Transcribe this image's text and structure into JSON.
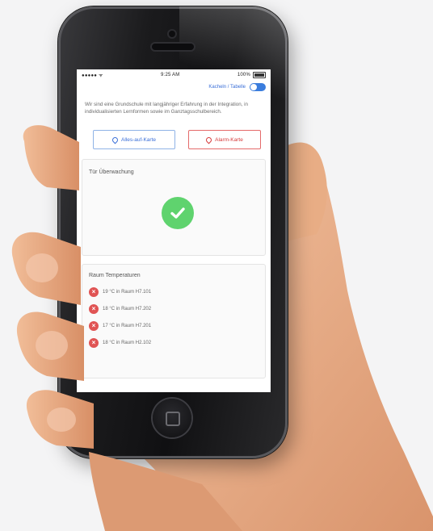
{
  "status_bar": {
    "carrier": "●●●●● ᯤ",
    "time": "9:25 AM",
    "battery": "100%"
  },
  "topbar": {
    "toggle_label": "Kacheln / Tabelle"
  },
  "intro_text": "Wir sind eine Grundschule mit langjähriger Erfahrung in der Integration, in individualisierten Lernformen sowie im Ganztagsschulbereich.",
  "buttons": {
    "all_map": "Alles-auf-Karte",
    "alarm_map": "Alarm-Karte"
  },
  "door_card": {
    "title": "Tür Überwachung"
  },
  "temp_card": {
    "title": "Raum Temperaturen",
    "items": [
      "19 °C in Raum H7.101",
      "18 °C in Raum H7.202",
      "17 °C in Raum H7.201",
      "18 °C in Raum H2.102"
    ]
  },
  "colors": {
    "accent_blue": "#3b7ddd",
    "alarm_red": "#d63a3a",
    "ok_green": "#5fd36e"
  }
}
